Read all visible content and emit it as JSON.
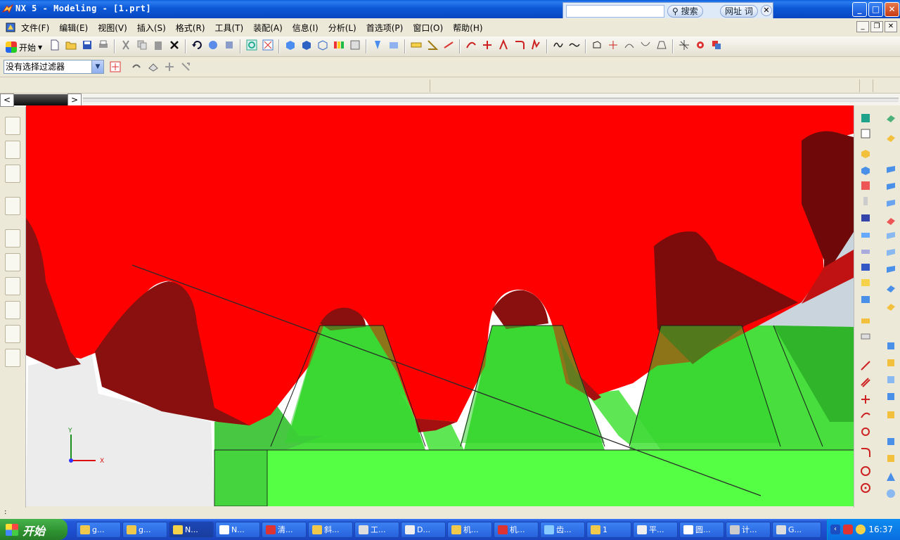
{
  "window": {
    "title": "NX 5 - Modeling - [1.prt]",
    "minimize": "_",
    "maximize": "□",
    "close": "✕"
  },
  "search_box": {
    "search_label": "搜索",
    "url_label": "网址 词",
    "close": "✕",
    "go_icon": "⊕"
  },
  "menu": {
    "items": [
      "文件(F)",
      "编辑(E)",
      "视图(V)",
      "插入(S)",
      "格式(R)",
      "工具(T)",
      "装配(A)",
      "信息(I)",
      "分析(L)",
      "首选项(P)",
      "窗口(O)",
      "帮助(H)"
    ]
  },
  "toolbar": {
    "start_label": "开始"
  },
  "selection": {
    "filter_value": "没有选择过滤器"
  },
  "navigator": {
    "prev": "<",
    "next": ">"
  },
  "viewport": {
    "gear_color": "#ff0000",
    "rack_color": "#33ee33",
    "background": "#ffffff",
    "axis_x": "X",
    "axis_y": "Y"
  },
  "status": {
    "text": ":"
  },
  "taskbar": {
    "start_label": "开始",
    "tasks": [
      "g...",
      "g...",
      "N...",
      "N...",
      "清...",
      "斜...",
      "工...",
      "D...",
      "机...",
      "机...",
      "齿...",
      "1",
      "平...",
      "圆...",
      "计...",
      "G..."
    ],
    "clock": "16:37"
  }
}
